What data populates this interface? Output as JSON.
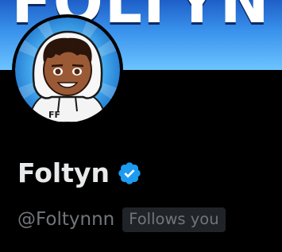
{
  "banner": {
    "text": "FOLTYN"
  },
  "profile": {
    "display_name": "Foltyn",
    "verified_icon": "verified-badge-icon",
    "handle": "@Foltynnn",
    "follows_badge": "Follows you"
  },
  "colors": {
    "background": "#000000",
    "name": "#e7e9ea",
    "secondary_text": "#71767b",
    "badge_bg": "#202327",
    "verified": "#1d9bf0",
    "banner_blue": "#3a93ec"
  }
}
